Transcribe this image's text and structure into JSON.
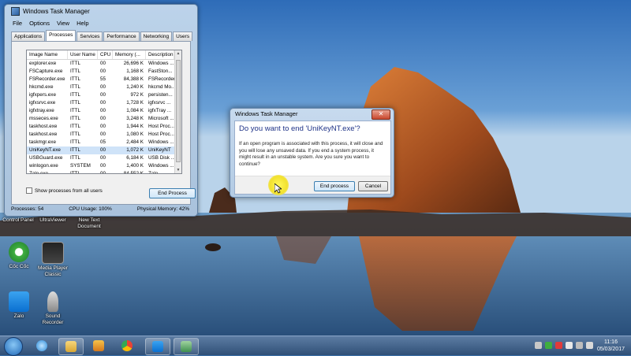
{
  "taskmanager": {
    "title": "Windows Task Manager",
    "menu": [
      "File",
      "Options",
      "View",
      "Help"
    ],
    "tabs": [
      "Applications",
      "Processes",
      "Services",
      "Performance",
      "Networking",
      "Users"
    ],
    "columns": [
      "Image Name",
      "User Name",
      "CPU",
      "Memory (...",
      "Description"
    ],
    "processes": [
      {
        "name": "explorer.exe",
        "user": "ITTL",
        "cpu": "00",
        "mem": "26,696 K",
        "desc": "Windows ..."
      },
      {
        "name": "FSCapture.exe",
        "user": "ITTL",
        "cpu": "00",
        "mem": "1,168 K",
        "desc": "FastSton..."
      },
      {
        "name": "FSRecorder.exe",
        "user": "ITTL",
        "cpu": "55",
        "mem": "84,388 K",
        "desc": "FSRecorder"
      },
      {
        "name": "hkcmd.exe",
        "user": "ITTL",
        "cpu": "00",
        "mem": "1,240 K",
        "desc": "hkcmd Mo..."
      },
      {
        "name": "igfxpers.exe",
        "user": "ITTL",
        "cpu": "00",
        "mem": "972 K",
        "desc": "persisten..."
      },
      {
        "name": "igfxsrvc.exe",
        "user": "ITTL",
        "cpu": "00",
        "mem": "1,728 K",
        "desc": "igfxsrvc ..."
      },
      {
        "name": "igfxtray.exe",
        "user": "ITTL",
        "cpu": "00",
        "mem": "1,084 K",
        "desc": "igfxTray ..."
      },
      {
        "name": "msseces.exe",
        "user": "ITTL",
        "cpu": "00",
        "mem": "3,248 K",
        "desc": "Microsoft ..."
      },
      {
        "name": "taskhost.exe",
        "user": "ITTL",
        "cpu": "00",
        "mem": "1,944 K",
        "desc": "Host Proc..."
      },
      {
        "name": "taskhost.exe",
        "user": "ITTL",
        "cpu": "00",
        "mem": "1,080 K",
        "desc": "Host Proc..."
      },
      {
        "name": "taskmgr.exe",
        "user": "ITTL",
        "cpu": "05",
        "mem": "2,484 K",
        "desc": "Windows ..."
      },
      {
        "name": "UniKeyNT.exe",
        "user": "ITTL",
        "cpu": "00",
        "mem": "1,072 K",
        "desc": "UniKeyNT"
      },
      {
        "name": "USBGuard.exe",
        "user": "ITTL",
        "cpu": "00",
        "mem": "6,184 K",
        "desc": "USB Disk ..."
      },
      {
        "name": "winlogon.exe",
        "user": "SYSTEM",
        "cpu": "00",
        "mem": "1,400 K",
        "desc": "Windows ..."
      },
      {
        "name": "Zalo.exe",
        "user": "ITTL",
        "cpu": "00",
        "mem": "84,552 K",
        "desc": "Zalo"
      }
    ],
    "show_all_label": "Show processes from all users",
    "end_process_label": "End Process",
    "status": {
      "processes": "Processes: 54",
      "cpu": "CPU Usage: 100%",
      "memory": "Physical Memory: 42%"
    }
  },
  "dialog": {
    "title": "Windows Task Manager",
    "question": "Do you want to end 'UniKeyNT.exe'?",
    "message": "If an open program is associated with this process, it will close and you will lose any unsaved data. If you end a system process, it might result in an unstable system. Are you sure you want to continue?",
    "end_label": "End process",
    "cancel_label": "Cancel",
    "close_glyph": "✕"
  },
  "desktop_icons": [
    {
      "label": "Control Panel"
    },
    {
      "label": "UltraViewer"
    },
    {
      "label": "New Text Document"
    },
    {
      "label": "Cốc Cốc"
    },
    {
      "label": "Media Player Classic"
    },
    {
      "label": "Zalo"
    },
    {
      "label": "Sound Recorder"
    }
  ],
  "clock": {
    "time": "11:16",
    "date": "05/03/2017"
  }
}
